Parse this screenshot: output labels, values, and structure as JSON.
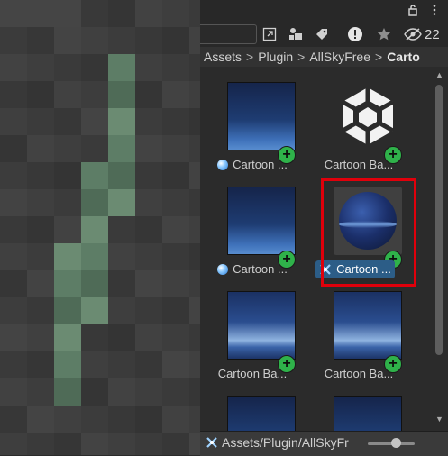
{
  "toolbar": {
    "search_placeholder": "",
    "hidden_count": "22"
  },
  "breadcrumb": [
    "Assets",
    "Plugin",
    "AllSkyFree",
    "Carto"
  ],
  "assets": [
    {
      "label": "Cartoon ...",
      "kind": "sky",
      "type_icon": "sphere-icon"
    },
    {
      "label": "Cartoon Ba...",
      "kind": "unity",
      "type_icon": ""
    },
    {
      "label": "Cartoon ...",
      "kind": "sky",
      "type_icon": "sphere-icon"
    },
    {
      "label": "Cartoon ...",
      "kind": "ball",
      "type_icon": "material-icon",
      "selected": true
    },
    {
      "label": "Cartoon Ba...",
      "kind": "band",
      "type_icon": ""
    },
    {
      "label": "Cartoon Ba...",
      "kind": "band",
      "type_icon": ""
    }
  ],
  "status": {
    "path": "Assets/Plugin/AllSkyFr"
  },
  "icon_size_slider": 0.6,
  "colors": {
    "accent_green": "#2fb24a",
    "selection_blue": "#2c5d87",
    "highlight_red": "#e0000b"
  }
}
